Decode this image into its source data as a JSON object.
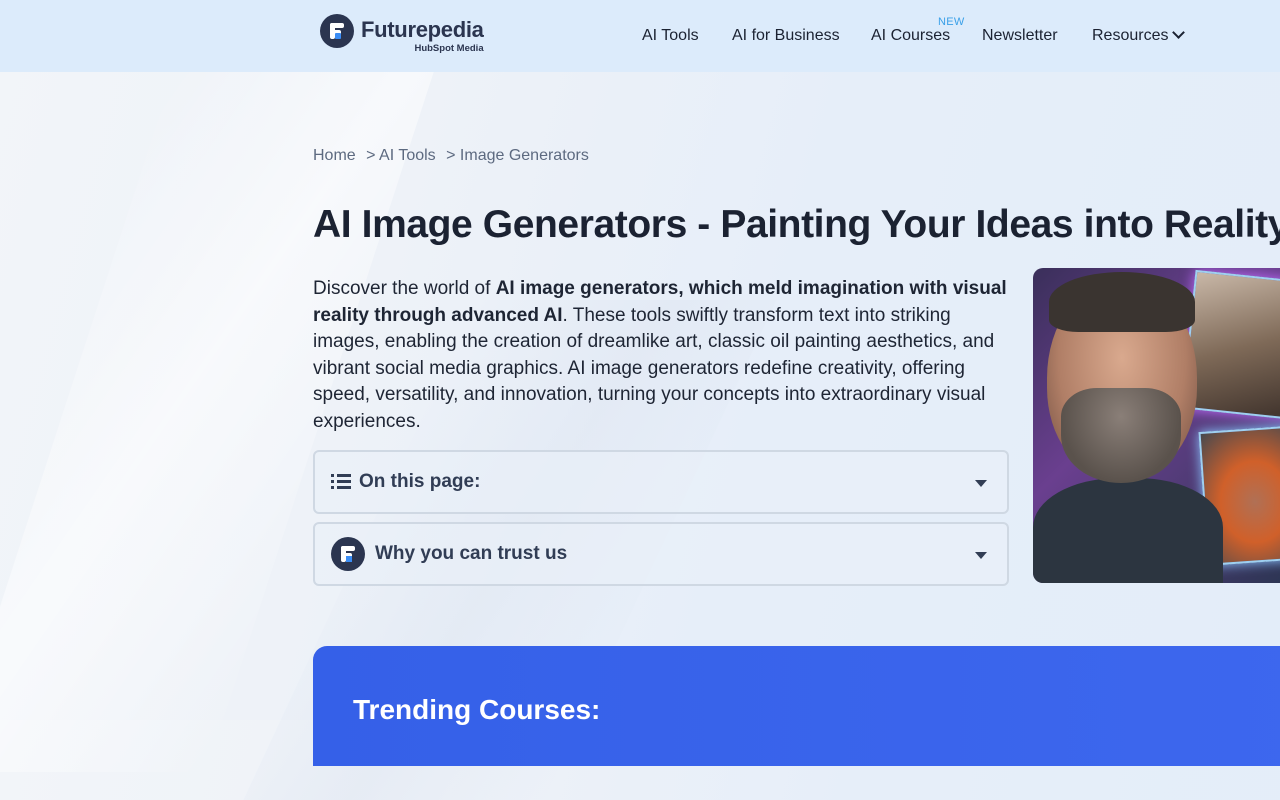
{
  "header": {
    "logo": {
      "name": "Futurepedia",
      "sub": "HubSpot Media"
    },
    "nav": [
      {
        "label": "AI Tools"
      },
      {
        "label": "AI for Business"
      },
      {
        "label": "AI Courses",
        "badge": "NEW"
      },
      {
        "label": "Newsletter"
      },
      {
        "label": "Resources",
        "has_dropdown": true
      }
    ]
  },
  "breadcrumb": {
    "items": [
      "Home",
      "> AI Tools",
      "> Image Generators"
    ]
  },
  "main": {
    "title": "AI Image Generators - Painting Your Ideas into Reality",
    "intro": {
      "lead": "Discover the world of ",
      "bold": "AI image generators, which meld imagination with visual reality through advanced AI",
      "rest": ". These tools swiftly transform text into striking images, enabling the creation of dreamlike art, classic oil painting aesthetics, and vibrant social media graphics. AI image generators redefine creativity, offering speed, versatility, and innovation, turning your concepts into extraordinary visual experiences."
    },
    "accordions": [
      {
        "label": "On this page:",
        "icon": "list-icon"
      },
      {
        "label": "Why you can trust us",
        "icon": "futurepedia-logo-icon"
      }
    ]
  },
  "trending": {
    "title": "Trending Courses:"
  },
  "colors": {
    "topbar": "#dcebfb",
    "accent": "#3b8df5",
    "banner": "#3560e8",
    "badge": "#3aa0e8"
  }
}
